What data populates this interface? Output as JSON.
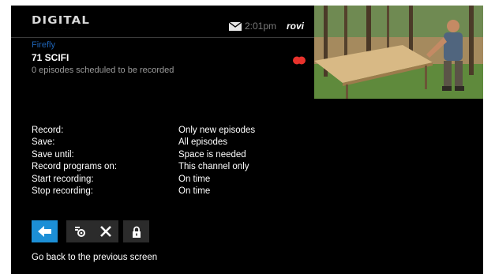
{
  "header": {
    "logo": "DIGITAL",
    "time": "2:01pm",
    "brand": "rovi"
  },
  "program": {
    "title": "Firefly",
    "channel": "71 SCIFI",
    "episodes_scheduled": "0 episodes scheduled to be recorded"
  },
  "settings": [
    {
      "label": "Record:",
      "value": "Only new episodes"
    },
    {
      "label": "Save:",
      "value": "All episodes"
    },
    {
      "label": "Save until:",
      "value": "Space is needed"
    },
    {
      "label": "Record programs on:",
      "value": "This channel only"
    },
    {
      "label": "Start recording:",
      "value": "On time"
    },
    {
      "label": "Stop recording:",
      "value": "On time"
    }
  ],
  "buttons": [
    {
      "icon": "back-arrow-icon"
    },
    {
      "icon": "gear-settings-icon"
    },
    {
      "icon": "close-x-icon"
    },
    {
      "icon": "lock-icon"
    }
  ],
  "help_text": "Go back to the previous screen",
  "colors": {
    "background": "#000000",
    "accent": "#1c8fd6",
    "title_blue": "#1e63b5",
    "record_red": "#e8322c",
    "button_gray": "#2b2b2b"
  }
}
